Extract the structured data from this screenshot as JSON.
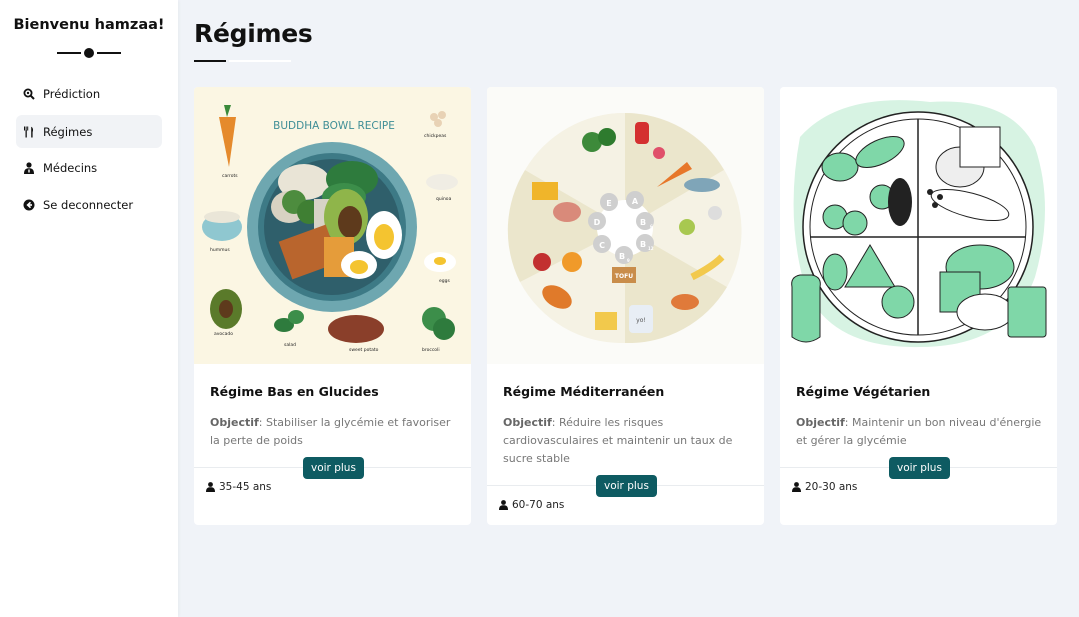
{
  "sidebar": {
    "welcome": "Bienvenu hamzaa!",
    "items": [
      {
        "label": "Prédiction",
        "icon": "search-icon"
      },
      {
        "label": "Régimes",
        "icon": "utensils-icon"
      },
      {
        "label": "Médecins",
        "icon": "doctor-icon"
      },
      {
        "label": "Se deconnecter",
        "icon": "logout-icon"
      }
    ],
    "active_index": 1
  },
  "main": {
    "title": "Régimes"
  },
  "cards": [
    {
      "title": "Régime Bas en Glucides",
      "objective_label": "Objectif",
      "objective_text": ": Stabiliser la glycémie et favoriser la perte de poids",
      "button": "voir plus",
      "age": "35-45 ans",
      "image_texts": {
        "heading": "BUDDHA BOWL RECIPE",
        "labels": [
          "carrots",
          "chickpeas",
          "quinoa",
          "hummus",
          "eggs",
          "avocado",
          "salad",
          "sweet potato",
          "broccoli"
        ]
      }
    },
    {
      "title": "Régime Méditerranéen",
      "objective_label": "Objectif",
      "objective_text": ": Réduire les risques cardiovasculaires et maintenir un taux de sucre stable",
      "button": "voir plus",
      "age": "60-70 ans",
      "image_texts": {
        "vitamins": [
          "A",
          "E",
          "D",
          "B",
          "C",
          "B",
          "B"
        ],
        "vitamin_subscripts": [
          "",
          "",
          "",
          "6",
          "",
          "12",
          "9"
        ],
        "tofu": "TOFU",
        "yogurt": "yo!"
      }
    },
    {
      "title": "Régime Végétarien",
      "objective_label": "Objectif",
      "objective_text": ": Maintenir un bon niveau d'énergie et gérer la glycémie",
      "button": "voir plus",
      "age": "20-30 ans"
    }
  ],
  "colors": {
    "accent": "#0e5b62",
    "page_background": "#f0f3f8",
    "sidebar_background": "#ffffff",
    "active_item_background": "#f1f3f6",
    "vegetarian_green": "#7fd7a8"
  }
}
